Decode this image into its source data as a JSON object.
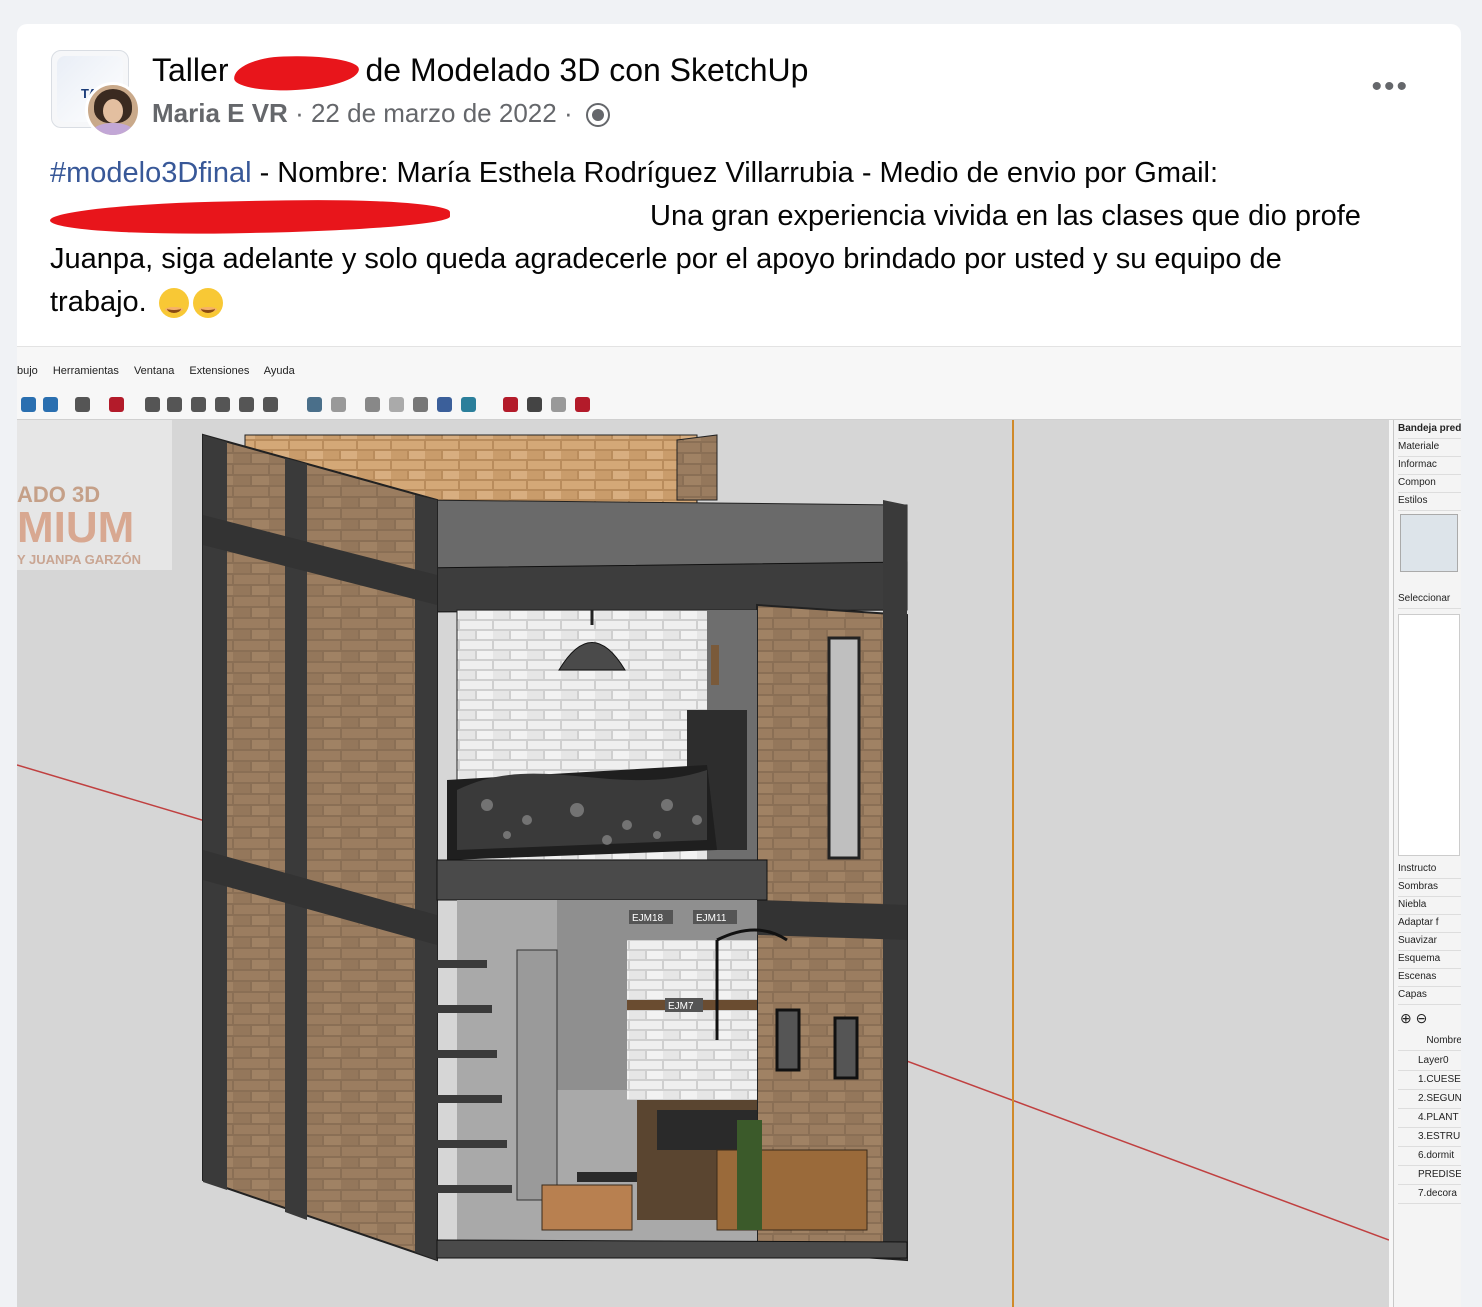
{
  "post": {
    "group_name_prefix": "Taller",
    "group_name_suffix": "de Modelado 3D con SketchUp",
    "author": "Maria E VR",
    "separator": "·",
    "date": "22 de marzo de 2022",
    "hashtag": "#modelo3Dfinal",
    "text_line1": " - Nombre: María Esthela Rodríguez Villarrubia - Medio de envio por Gmail:",
    "text_line2": "Una gran experiencia vivida en las clases que dio profe Juanpa, siga adelante y solo queda agradecerle por el apoyo brindado por usted y su equipo de trabajo.",
    "more_label": "•••"
  },
  "sketchup": {
    "menu": [
      "bujo",
      "Herramientas",
      "Ventana",
      "Extensiones",
      "Ayuda"
    ],
    "watermark": {
      "line1": "ADO 3D",
      "line2": "MIUM",
      "line3": "Y JUANPA GARZÓN"
    },
    "tray": {
      "title": "Bandeja pred",
      "top_items": [
        "Materiale",
        "Informac",
        "Compon",
        "Estilos"
      ],
      "select_label": "Seleccionar",
      "bottom_items": [
        "Instructo",
        "Sombras",
        "Niebla",
        "Adaptar f",
        "Suavizar",
        "Esquema",
        "Escenas",
        "Capas"
      ],
      "layers_header": "Nombre",
      "layers": [
        "Layer0",
        "1.CUESE",
        "2.SEGUN",
        "4.PLANT",
        "3.ESTRU",
        "6.dormit",
        "PREDISE",
        "7.decora"
      ]
    },
    "model_labels": [
      "EJM18",
      "EJM11",
      "EJM7"
    ]
  }
}
